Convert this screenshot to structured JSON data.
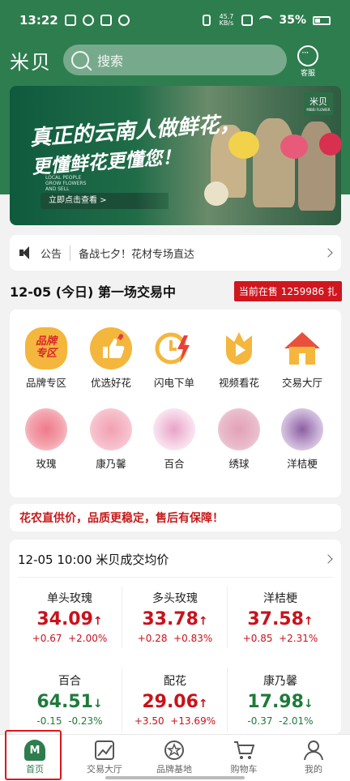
{
  "status_bar": {
    "time": "13:22",
    "net_speed": "45.7\nKB/s",
    "battery": "35%"
  },
  "header": {
    "app_name": "米贝",
    "search_placeholder": "搜索",
    "service_label": "客服"
  },
  "banner": {
    "line1": "真正的云南人做鲜花，",
    "line2": "更懂鲜花更懂您！",
    "cta": "立即点击查看 >",
    "brand": "米贝",
    "brand_en": "LOCAL PEOPLE GROW FLOWERS AND SELL",
    "brand_en_small": "MIBEI FLOWER"
  },
  "notice": {
    "tag": "公告",
    "text": "备战七夕！花材专场直达"
  },
  "trade": {
    "title": "12-05 (今日) 第一场交易中",
    "badge": "当前在售 1259986 扎"
  },
  "categories": [
    {
      "label": "品牌专区",
      "icon": "brand-zone-icon",
      "icon_text": "品牌\n专区"
    },
    {
      "label": "优选好花",
      "icon": "thumbs-up-icon"
    },
    {
      "label": "闪电下单",
      "icon": "lightning-clock-icon"
    },
    {
      "label": "视频看花",
      "icon": "video-flower-icon"
    },
    {
      "label": "交易大厅",
      "icon": "house-icon"
    },
    {
      "label": "玫瑰",
      "icon": "rose-icon"
    },
    {
      "label": "康乃馨",
      "icon": "carnation-icon"
    },
    {
      "label": "百合",
      "icon": "lily-icon"
    },
    {
      "label": "绣球",
      "icon": "hydrangea-icon"
    },
    {
      "label": "洋桔梗",
      "icon": "eustoma-icon"
    }
  ],
  "promo": {
    "text": "花农直供价，品质更稳定，售后有保障！"
  },
  "prices": {
    "title": "12-05 10:00 米贝成交均价",
    "items": [
      {
        "name": "单头玫瑰",
        "price": "34.09",
        "arrow": "↑",
        "change": "+0.67",
        "pct": "+2.00%",
        "dir": "up"
      },
      {
        "name": "多头玫瑰",
        "price": "33.78",
        "arrow": "↑",
        "change": "+0.28",
        "pct": "+0.83%",
        "dir": "up"
      },
      {
        "name": "洋桔梗",
        "price": "37.58",
        "arrow": "↑",
        "change": "+0.85",
        "pct": "+2.31%",
        "dir": "up"
      },
      {
        "name": "百合",
        "price": "64.51",
        "arrow": "↓",
        "change": "-0.15",
        "pct": "-0.23%",
        "dir": "down"
      },
      {
        "name": "配花",
        "price": "29.06",
        "arrow": "↑",
        "change": "+3.50",
        "pct": "+13.69%",
        "dir": "up"
      },
      {
        "name": "康乃馨",
        "price": "17.98",
        "arrow": "↓",
        "change": "-0.37",
        "pct": "-2.01%",
        "dir": "down"
      }
    ]
  },
  "tabbar": {
    "items": [
      {
        "label": "首页",
        "icon": "home-icon",
        "icon_text": "M"
      },
      {
        "label": "交易大厅",
        "icon": "trading-chart-icon"
      },
      {
        "label": "品牌基地",
        "icon": "brand-badge-icon"
      },
      {
        "label": "购物车",
        "icon": "cart-icon"
      },
      {
        "label": "我的",
        "icon": "profile-icon"
      }
    ]
  },
  "colors": {
    "brand_green": "#2e7d4f",
    "up_red": "#c8121b",
    "down_green": "#1f7a3b",
    "highlight": "#e0151a"
  }
}
